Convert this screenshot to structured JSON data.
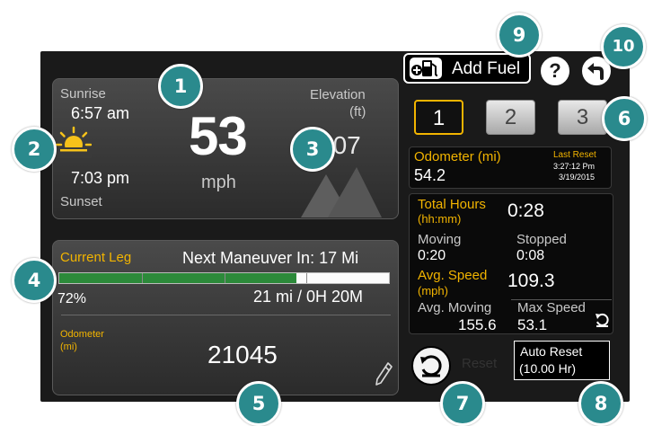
{
  "speed_panel": {
    "sunrise_label": "Sunrise",
    "sunrise_time": "6:57 am",
    "sunset_time": "7:03 pm",
    "sunset_label": "Sunset",
    "speed_value": "53",
    "speed_unit": "mph",
    "elevation_label": "Elevation",
    "elevation_unit": "(ft)",
    "elevation_value": "607"
  },
  "leg_panel": {
    "current_leg_label": "Current Leg",
    "next_maneuver": "Next Maneuver In: 17 Mi",
    "progress_text": "72%",
    "progress_fraction": 0.72,
    "distance_time": "21 mi / 0H 20M",
    "odometer_label_line1": "Odometer",
    "odometer_label_line2": "(mi)",
    "odometer_value": "21045"
  },
  "toolbar": {
    "add_fuel_label": "Add Fuel",
    "help_label": "?"
  },
  "trips": [
    {
      "label": "1",
      "active": true
    },
    {
      "label": "2",
      "active": false
    },
    {
      "label": "3",
      "active": false
    }
  ],
  "trip_odometer": {
    "label": "Odometer (mi)",
    "value": "54.2",
    "last_reset_label": "Last Reset",
    "last_reset_time": "3:27:12 Pm",
    "last_reset_date": "3/19/2015"
  },
  "stats": {
    "total_hours_label_line1": "Total Hours",
    "total_hours_label_line2": "(hh:mm)",
    "total_hours_value": "0:28",
    "moving_label": "Moving",
    "moving_value": "0:20",
    "stopped_label": "Stopped",
    "stopped_value": "0:08",
    "avg_speed_label_line1": "Avg. Speed",
    "avg_speed_label_line2": "(mph)",
    "avg_speed_value": "109.3",
    "avg_moving_label": "Avg. Moving",
    "avg_moving_value": "155.6",
    "max_speed_label": "Max Speed",
    "max_speed_value": "53.1"
  },
  "reset": {
    "reset_label": "Reset",
    "auto_reset_line1": "Auto Reset",
    "auto_reset_line2": "(10.00 Hr)"
  },
  "callouts": [
    "1",
    "2",
    "3",
    "4",
    "5",
    "6",
    "7",
    "8",
    "9",
    "10"
  ],
  "colors": {
    "callout": "#2a8a8d",
    "accent_yellow": "#f2b400",
    "progress_green": "#2c8a3a"
  }
}
